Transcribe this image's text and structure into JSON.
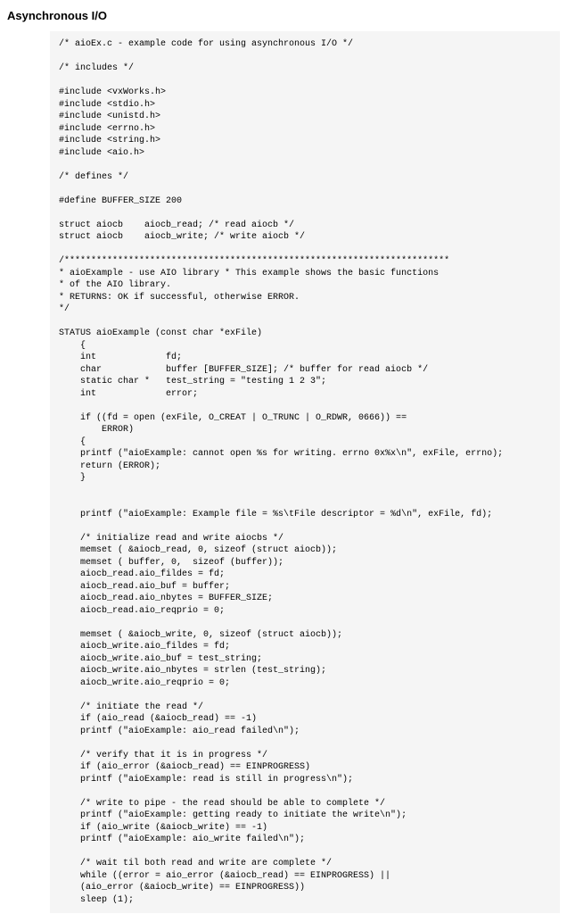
{
  "section_title": "Asynchronous I/O",
  "code": "/* aioEx.c - example code for using asynchronous I/O */\n\n/* includes */\n\n#include <vxWorks.h>\n#include <stdio.h>\n#include <unistd.h>\n#include <errno.h>\n#include <string.h>\n#include <aio.h>\n\n/* defines */\n\n#define BUFFER_SIZE 200\n\nstruct aiocb    aiocb_read; /* read aiocb */\nstruct aiocb    aiocb_write; /* write aiocb */\n\n/************************************************************************\n* aioExample - use AIO library * This example shows the basic functions\n* of the AIO library.\n* RETURNS: OK if successful, otherwise ERROR.\n*/\n\nSTATUS aioExample (const char *exFile)\n    {\n    int             fd;\n    char            buffer [BUFFER_SIZE]; /* buffer for read aiocb */\n    static char *   test_string = \"testing 1 2 3\";\n    int             error;\n\n    if ((fd = open (exFile, O_CREAT | O_TRUNC | O_RDWR, 0666)) ==\n        ERROR)\n    {\n    printf (\"aioExample: cannot open %s for writing. errno 0x%x\\n\", exFile, errno);\n    return (ERROR);\n    }\n\n\n    printf (\"aioExample: Example file = %s\\tFile descriptor = %d\\n\", exFile, fd);\n\n    /* initialize read and write aiocbs */\n    memset ( &aiocb_read, 0, sizeof (struct aiocb));\n    memset ( buffer, 0,  sizeof (buffer));\n    aiocb_read.aio_fildes = fd;\n    aiocb_read.aio_buf = buffer;\n    aiocb_read.aio_nbytes = BUFFER_SIZE;\n    aiocb_read.aio_reqprio = 0;\n\n    memset ( &aiocb_write, 0, sizeof (struct aiocb));\n    aiocb_write.aio_fildes = fd;\n    aiocb_write.aio_buf = test_string;\n    aiocb_write.aio_nbytes = strlen (test_string);\n    aiocb_write.aio_reqprio = 0;\n\n    /* initiate the read */\n    if (aio_read (&aiocb_read) == -1)\n    printf (\"aioExample: aio_read failed\\n\");\n\n    /* verify that it is in progress */\n    if (aio_error (&aiocb_read) == EINPROGRESS)\n    printf (\"aioExample: read is still in progress\\n\");\n\n    /* write to pipe - the read should be able to complete */\n    printf (\"aioExample: getting ready to initiate the write\\n\");\n    if (aio_write (&aiocb_write) == -1)\n    printf (\"aioExample: aio_write failed\\n\");\n\n    /* wait til both read and write are complete */\n    while ((error = aio_error (&aiocb_read) == EINPROGRESS) ||\n    (aio_error (&aiocb_write) == EINPROGRESS))\n    sleep (1);"
}
